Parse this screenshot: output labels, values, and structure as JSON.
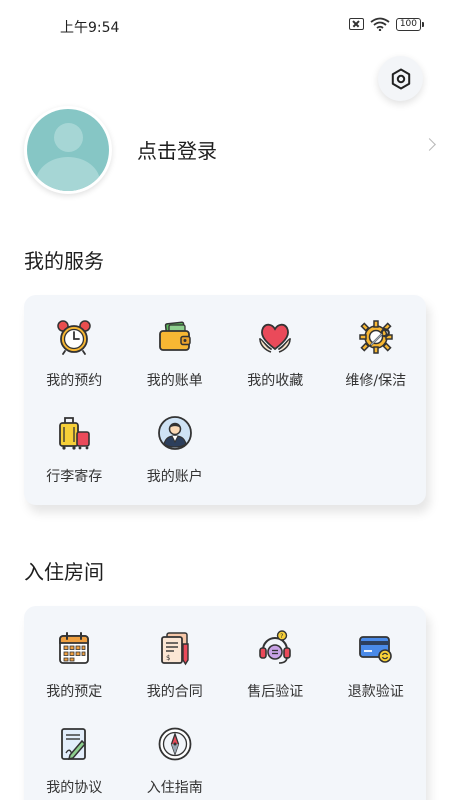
{
  "status_bar": {
    "time": "上午9:54",
    "battery": "100"
  },
  "profile": {
    "login_label": "点击登录"
  },
  "services": {
    "title": "我的服务",
    "items": [
      {
        "label": "我的预约",
        "icon": "alarm-clock-icon"
      },
      {
        "label": "我的账单",
        "icon": "wallet-icon"
      },
      {
        "label": "我的收藏",
        "icon": "heart-hands-icon"
      },
      {
        "label": "维修/保洁",
        "icon": "gear-wrench-icon"
      },
      {
        "label": "行李寄存",
        "icon": "luggage-icon"
      },
      {
        "label": "我的账户",
        "icon": "account-icon"
      }
    ]
  },
  "rooms": {
    "title": "入住房间",
    "items": [
      {
        "label": "我的预定",
        "icon": "calendar-icon"
      },
      {
        "label": "我的合同",
        "icon": "contract-icon"
      },
      {
        "label": "售后验证",
        "icon": "headset-icon"
      },
      {
        "label": "退款验证",
        "icon": "refund-card-icon"
      },
      {
        "label": "我的协议",
        "icon": "agreement-icon"
      },
      {
        "label": "入住指南",
        "icon": "compass-icon"
      }
    ]
  }
}
